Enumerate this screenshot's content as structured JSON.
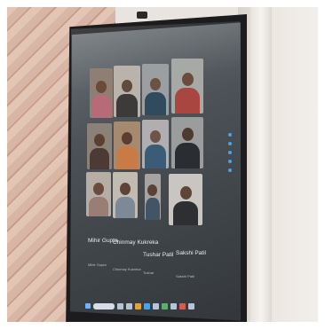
{
  "photo": {
    "subject": "",
    "participants": [
      {
        "name": "Mihir Gupta",
        "sub": "Mihir Gupta"
      },
      {
        "name": "Chinmay Kukreka",
        "sub": "Chinmay Kukreka"
      },
      {
        "name": "Tushar Patil",
        "sub": "Tushar"
      },
      {
        "name": "Sakshi Patil",
        "sub": "Sakshi Patil"
      }
    ],
    "colors": {
      "screen": "#4c5257",
      "bezel": "#1c1c1f",
      "wall_pattern": "#d8b6a6",
      "accent_icons": "#4aa3e8"
    }
  }
}
